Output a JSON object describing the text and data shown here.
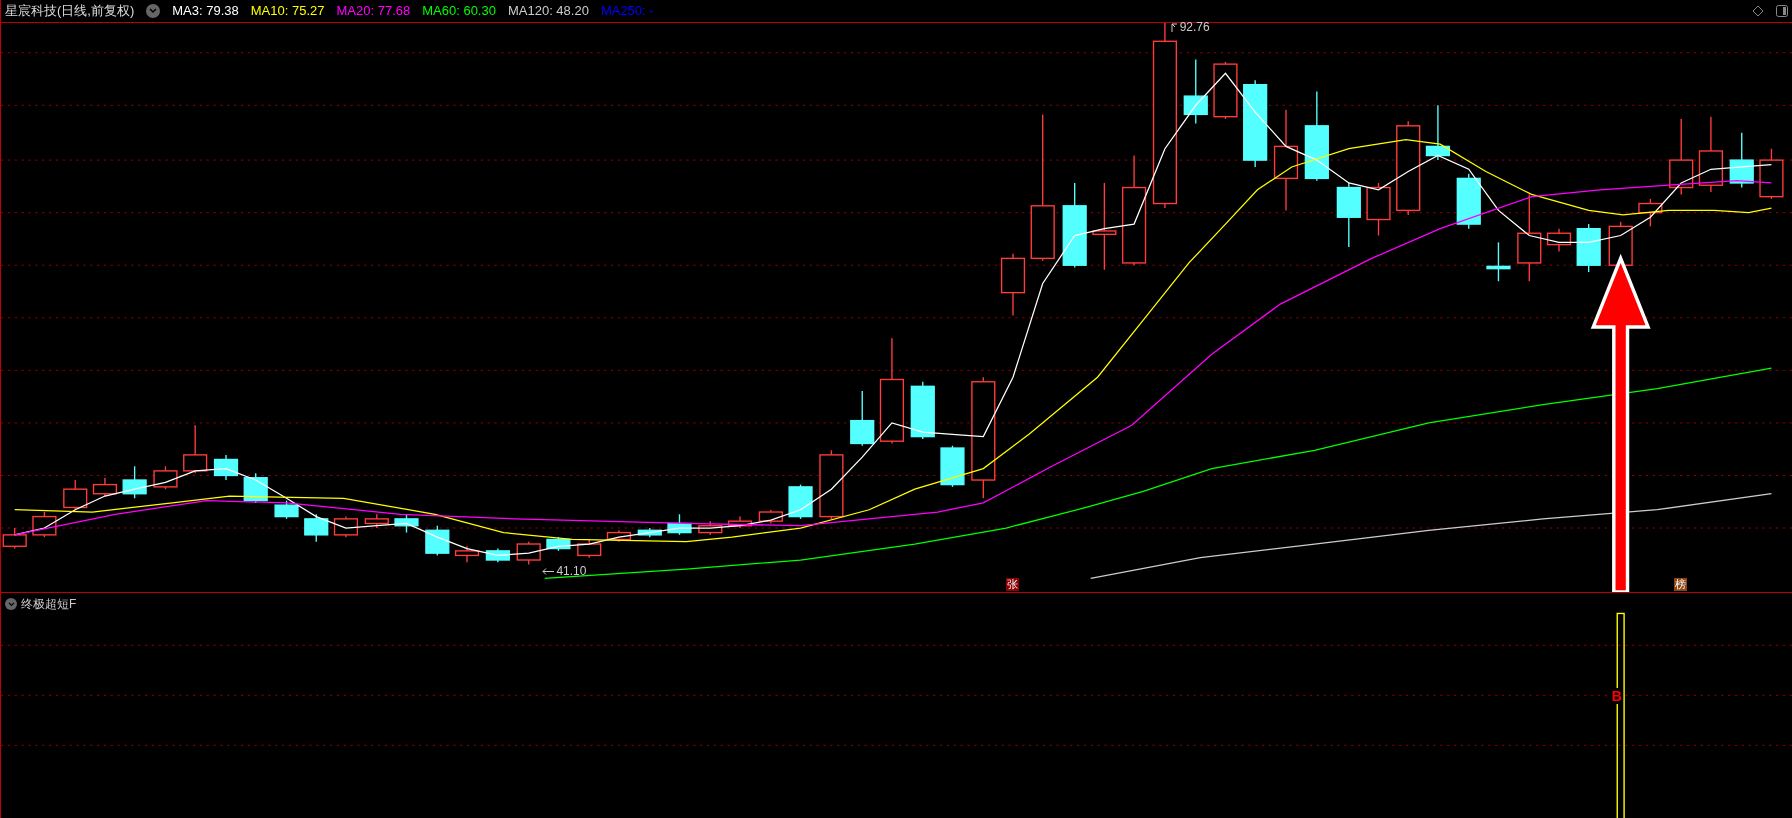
{
  "title": "星宸科技(日线,前复权)",
  "legend": [
    {
      "label": "MA3: 79.38",
      "color": "#ffffff"
    },
    {
      "label": "MA10: 75.27",
      "color": "#ffff00"
    },
    {
      "label": "MA20: 77.68",
      "color": "#ff00ff"
    },
    {
      "label": "MA60: 60.30",
      "color": "#00ff00"
    },
    {
      "label": "MA120: 48.20",
      "color": "#cccccc"
    },
    {
      "label": "MA250: -",
      "color": "#0000ff"
    }
  ],
  "price_labels": [
    {
      "text": "92.76",
      "kind": "high"
    },
    {
      "text": "41.10",
      "kind": "low"
    }
  ],
  "markers": [
    {
      "text": "张",
      "color": "#8b0000"
    },
    {
      "text": "榜",
      "color": "#8b4513"
    }
  ],
  "indicator": {
    "name": "终极超短F",
    "signal": "B"
  }
}
